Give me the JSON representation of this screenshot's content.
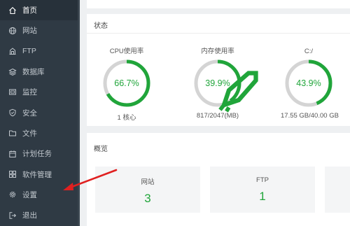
{
  "sidebar": {
    "items": [
      {
        "label": "首页",
        "icon": "home-icon"
      },
      {
        "label": "网站",
        "icon": "globe-icon"
      },
      {
        "label": "FTP",
        "icon": "ftp-icon"
      },
      {
        "label": "数据库",
        "icon": "database-icon"
      },
      {
        "label": "监控",
        "icon": "monitor-icon"
      },
      {
        "label": "安全",
        "icon": "shield-icon"
      },
      {
        "label": "文件",
        "icon": "folder-icon"
      },
      {
        "label": "计划任务",
        "icon": "calendar-icon"
      },
      {
        "label": "软件管理",
        "icon": "apps-icon"
      },
      {
        "label": "设置",
        "icon": "gear-icon"
      },
      {
        "label": "退出",
        "icon": "logout-icon"
      }
    ]
  },
  "status": {
    "title": "状态",
    "gauges": [
      {
        "label": "CPU使用率",
        "value": "66.7%",
        "sub": "1 核心",
        "percent": 66.7
      },
      {
        "label": "内存使用率",
        "value": "39.9%",
        "sub": "817/2047(MB)",
        "percent": 39.9
      },
      {
        "label": "C:/",
        "value": "43.9%",
        "sub": "17.55 GB/40.00 GB",
        "percent": 43.9
      }
    ]
  },
  "overview": {
    "title": "概览",
    "cards": [
      {
        "label": "网站",
        "value": "3"
      },
      {
        "label": "FTP",
        "value": "1"
      }
    ]
  },
  "colors": {
    "sidebar_bg": "#2f3a44",
    "accent_green": "#20a53a",
    "ring_track": "#d4d4d4",
    "annotation_red": "#e02020"
  }
}
